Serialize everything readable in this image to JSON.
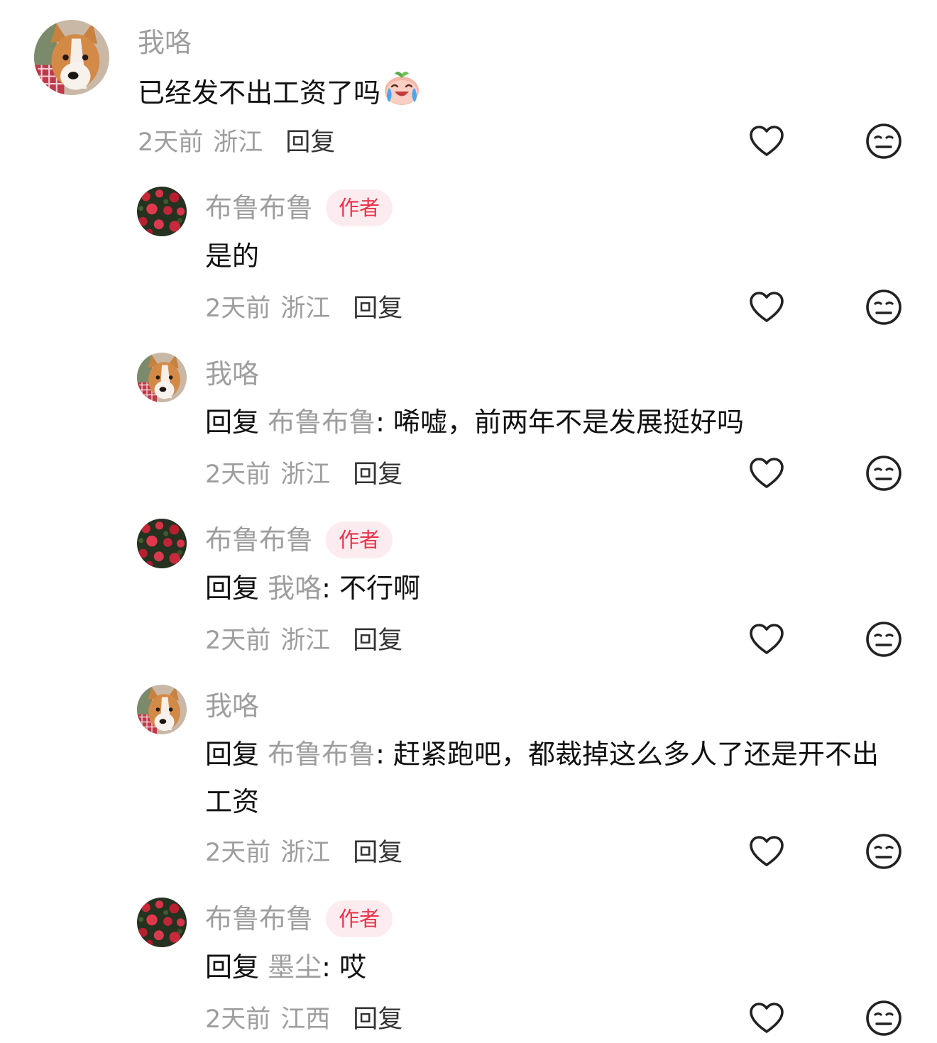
{
  "comments": [
    {
      "username": "我咯",
      "is_author": false,
      "avatar": "corgi-avatar",
      "reply_label": "",
      "reply_target": "",
      "text": "已经发不出工资了吗",
      "emoji": "crying-laughing-peach-emoji",
      "time": "2天前",
      "location": "浙江",
      "reply_button": "回复"
    },
    {
      "username": "布鲁布鲁",
      "is_author": true,
      "author_badge": "作者",
      "avatar": "red-flowers-avatar",
      "reply_label": "",
      "reply_target": "",
      "text": "是的",
      "time": "2天前",
      "location": "浙江",
      "reply_button": "回复"
    },
    {
      "username": "我咯",
      "is_author": false,
      "avatar": "corgi-avatar",
      "reply_label": "回复",
      "reply_target": "布鲁布鲁",
      "text": "唏嘘，前两年不是发展挺好吗",
      "time": "2天前",
      "location": "浙江",
      "reply_button": "回复"
    },
    {
      "username": "布鲁布鲁",
      "is_author": true,
      "author_badge": "作者",
      "avatar": "red-flowers-avatar",
      "reply_label": "回复",
      "reply_target": "我咯",
      "text": "不行啊",
      "time": "2天前",
      "location": "浙江",
      "reply_button": "回复"
    },
    {
      "username": "我咯",
      "is_author": false,
      "avatar": "corgi-avatar",
      "reply_label": "回复",
      "reply_target": "布鲁布鲁",
      "text": "赶紧跑吧，都裁掉这么多人了还是开不出工资",
      "time": "2天前",
      "location": "浙江",
      "reply_button": "回复"
    },
    {
      "username": "布鲁布鲁",
      "is_author": true,
      "author_badge": "作者",
      "avatar": "red-flowers-avatar",
      "reply_label": "回复",
      "reply_target": "墨尘",
      "text": "哎",
      "time": "2天前",
      "location": "江西",
      "reply_button": "回复"
    }
  ],
  "icons": {
    "like": "heart-outline-icon",
    "dislike": "meh-face-icon"
  },
  "colors": {
    "author_badge_bg": "#fdecef",
    "author_badge_text": "#e8334a",
    "secondary_text": "#9e9e9e",
    "primary_text": "#111111",
    "icon_stroke": "#222222"
  }
}
